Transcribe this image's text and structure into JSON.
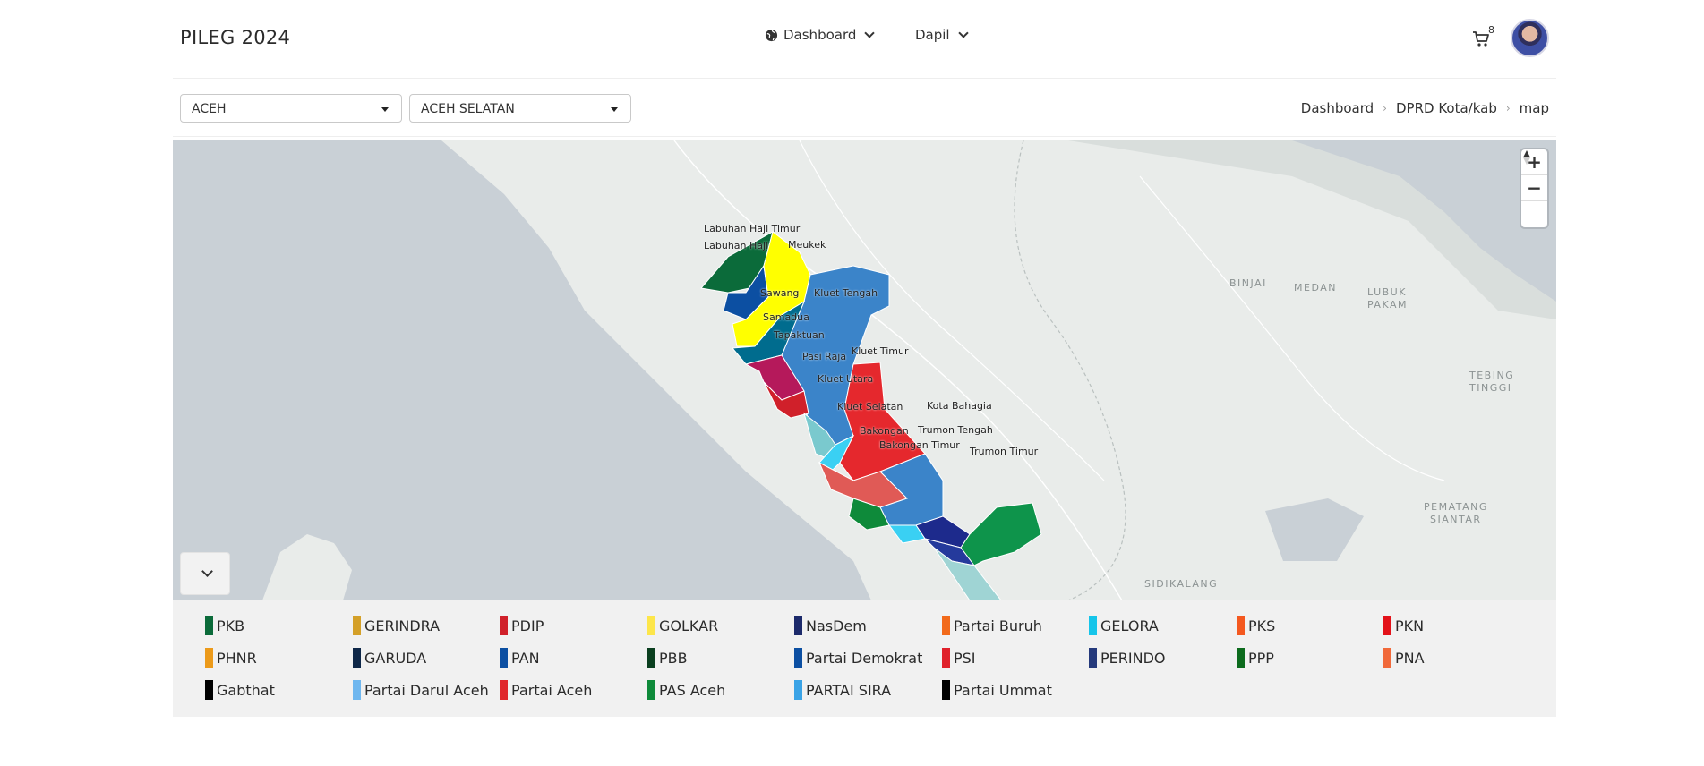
{
  "header": {
    "brand": "PILEG 2024",
    "nav_dashboard": "Dashboard",
    "nav_dapil": "Dapil",
    "cart_count": "8"
  },
  "filters": {
    "province": "ACEH",
    "regency": "ACEH SELATAN"
  },
  "breadcrumb": [
    "Dashboard",
    "DPRD Kota/kab",
    "map"
  ],
  "map": {
    "district_labels": [
      "Labuhan Haji Timur",
      "Labuhan Haji",
      "Meukek",
      "Sawang",
      "Kluet Tengah",
      "Samadua",
      "Tapaktuan",
      "Kluet Timur",
      "Pasi Raja",
      "Kluet Utara",
      "Kluet Selatan",
      "Kota Bahagia",
      "Bakongan",
      "Trumon Tengah",
      "Bakongan Timur",
      "Trumon Timur"
    ],
    "city_labels": [
      "BINJAI",
      "MEDAN",
      "LUBUK",
      "PAKAM",
      "TEBING",
      "TINGGI",
      "PEMATANG",
      "SIANTAR",
      "SIDIKALANG"
    ],
    "zoom_in": "+",
    "zoom_out": "−"
  },
  "legend": [
    {
      "name": "PKB",
      "color": "#0b6b3a"
    },
    {
      "name": "GERINDRA",
      "color": "#d4a028"
    },
    {
      "name": "PDIP",
      "color": "#d0202a"
    },
    {
      "name": "GOLKAR",
      "color": "#fde64a"
    },
    {
      "name": "NasDem",
      "color": "#1c2a6b"
    },
    {
      "name": "Partai Buruh",
      "color": "#f26a1b"
    },
    {
      "name": "GELORA",
      "color": "#16c5ea"
    },
    {
      "name": "PKS",
      "color": "#f4581f"
    },
    {
      "name": "PKN",
      "color": "#e3121a"
    },
    {
      "name": "PHNR",
      "color": "#ec9a1a"
    },
    {
      "name": "GARUDA",
      "color": "#0e2748"
    },
    {
      "name": "PAN",
      "color": "#0c4fa2"
    },
    {
      "name": "PBB",
      "color": "#0a3f1f"
    },
    {
      "name": "Partai Demokrat",
      "color": "#0c4fa2"
    },
    {
      "name": "PSI",
      "color": "#e0212b"
    },
    {
      "name": "PERINDO",
      "color": "#253a7c"
    },
    {
      "name": "PPP",
      "color": "#0c6b1d"
    },
    {
      "name": "PNA",
      "color": "#f1693a"
    },
    {
      "name": "Gabthat",
      "color": "#000000"
    },
    {
      "name": "Partai Darul Aceh",
      "color": "#6fb7ef"
    },
    {
      "name": "Partai Aceh",
      "color": "#e0262b"
    },
    {
      "name": "PAS Aceh",
      "color": "#0e8a3a"
    },
    {
      "name": "PARTAI SIRA",
      "color": "#3aa3e6"
    },
    {
      "name": "Partai Ummat",
      "color": "#000000"
    }
  ]
}
